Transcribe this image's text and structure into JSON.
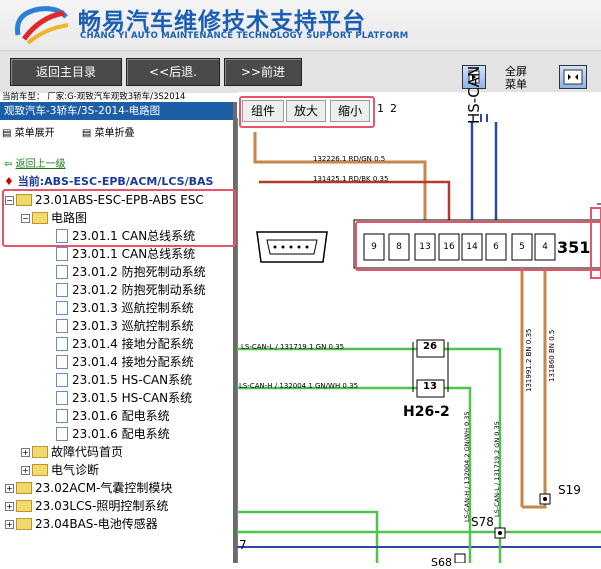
{
  "header": {
    "title_cn": "畅易汽车维修技术支持平台",
    "title_en": "CHANG YI AUTO MAINTENANCE TECHNOLOGY SUPPORT PLATFORM"
  },
  "nav": {
    "back_main": "返回主目录",
    "back": "<<后退.",
    "forward": ">>前进",
    "fullscreen_line1": "全屏",
    "fullscreen_line2": "菜单"
  },
  "car_model": "当前车型：  厂家:G-观致汽车观致3轿车/3S2014",
  "sidebar": {
    "header": "观致汽车-3轿车/3S-2014-电路图",
    "expand": "菜单展开",
    "collapse": "菜单折叠",
    "up_level": "返回上一级",
    "current": "当前:ABS-ESC-EPB/ACM/LCS/BAS"
  },
  "tree": {
    "n0": "23.01ABS-ESC-EPB-ABS ESC",
    "n1": "电路图",
    "i0": "23.01.1 CAN总线系统",
    "i1": "23.01.1 CAN总线系统",
    "i2": "23.01.2 防抱死制动系统",
    "i3": "23.01.2 防抱死制动系统",
    "i4": "23.01.3 巡航控制系统",
    "i5": "23.01.3 巡航控制系统",
    "i6": "23.01.4 接地分配系统",
    "i7": "23.01.4 接地分配系统",
    "i8": "23.01.5 HS-CAN系统",
    "i9": "23.01.5 HS-CAN系统",
    "i10": "23.01.6 配电系统",
    "i11": "23.01.6 配电系统",
    "f1": "故障代码首页",
    "f2": "电气诊断",
    "r1": "23.02ACM-气囊控制模块",
    "r2": "23.03LCS-照明控制系统",
    "r3": "23.04BAS-电池传感器"
  },
  "toolbar": {
    "components": "组件",
    "zoom_in": "放大",
    "zoom_out": "缩小",
    "page1": "1",
    "page2": "2"
  },
  "diagram": {
    "hs_can": "HS-CAN",
    "wire1": "132226.1 RD/GN 0.5",
    "wire2": "131425.1 RD/BK 0.35",
    "pins": [
      "9",
      "8",
      "13",
      "16",
      "14",
      "6",
      "5",
      "4"
    ],
    "connector": "351",
    "ls_can_l": "LS-CAN-L / 131719.1 GN 0.35",
    "ls_can_h": "LS-CAN-H / 132004.1 GN/WH 0.35",
    "pin26": "26",
    "pin13": "13",
    "h26": "H26-2",
    "v1": "131991.2 BN 0.35",
    "v2": "131860 BN 0.5",
    "v3": "LS-CAN-H / 132004.2 GN/WH 0.35",
    "v4": "LS-CAN-L / 131719.2 GN 0.35",
    "s19": "S19",
    "s78": "S78",
    "s68": "S68",
    "seven": "7",
    "colors": {
      "brown": "#c7864a",
      "green": "#4fc24f",
      "blue": "#2a4aa8",
      "highlight": "#e8546a",
      "nav_bg": "#4a4a4a",
      "sidebar_head": "#1d5fa6"
    }
  }
}
